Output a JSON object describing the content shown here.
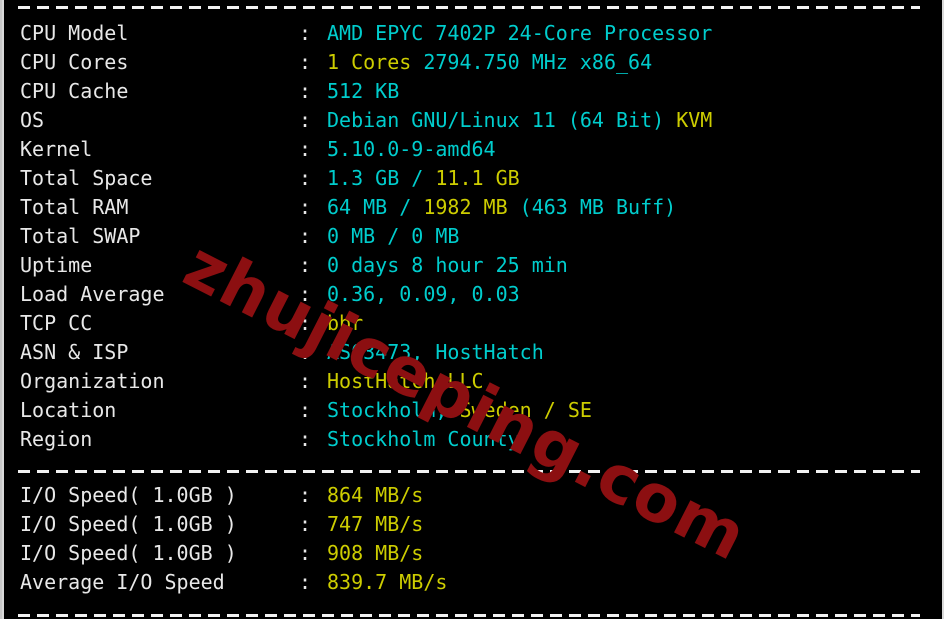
{
  "terminal": {
    "background_color": "#000000",
    "label_color": "#e8e8e8",
    "cyan": "#00cdcd",
    "yellow": "#cdcd00",
    "separator_char": "-"
  },
  "watermark": {
    "text": "zhujiceping.com",
    "color": "#8c0f11"
  },
  "separators": {
    "top": "----------------------------------------------------------------------",
    "middle": "----------------------------------------------------------------------",
    "bottom": "----------------------------------------------------------------------"
  },
  "system_info": {
    "colon": ":",
    "rows": [
      {
        "label": "CPU Model",
        "value_plain": "AMD EPYC 7402P 24-Core Processor",
        "parts": [
          {
            "text": "AMD EPYC 7402P 24-Core Processor",
            "color": "cyan"
          }
        ]
      },
      {
        "label": "CPU Cores",
        "value_plain": "1 Cores 2794.750 MHz x86_64",
        "parts": [
          {
            "text": "1 Cores",
            "color": "yellow"
          },
          {
            "text": " 2794.750 MHz x86_64",
            "color": "cyan"
          }
        ]
      },
      {
        "label": "CPU Cache",
        "value_plain": "512 KB",
        "parts": [
          {
            "text": "512 KB",
            "color": "cyan"
          }
        ]
      },
      {
        "label": "OS",
        "value_plain": "Debian GNU/Linux 11 (64 Bit) KVM",
        "parts": [
          {
            "text": "Debian GNU/Linux 11 (64 Bit) ",
            "color": "cyan"
          },
          {
            "text": "KVM",
            "color": "yellow"
          }
        ]
      },
      {
        "label": "Kernel",
        "value_plain": "5.10.0-9-amd64",
        "parts": [
          {
            "text": "5.10.0-9-amd64",
            "color": "cyan"
          }
        ]
      },
      {
        "label": "Total Space",
        "value_plain": "1.3 GB / 11.1 GB",
        "parts": [
          {
            "text": "1.3 GB / ",
            "color": "cyan"
          },
          {
            "text": "11.1 GB",
            "color": "yellow"
          }
        ]
      },
      {
        "label": "Total RAM",
        "value_plain": "64 MB / 1982 MB (463 MB Buff)",
        "parts": [
          {
            "text": "64 MB / ",
            "color": "cyan"
          },
          {
            "text": "1982 MB",
            "color": "yellow"
          },
          {
            "text": " (463 MB Buff)",
            "color": "cyan"
          }
        ]
      },
      {
        "label": "Total SWAP",
        "value_plain": "0 MB / 0 MB",
        "parts": [
          {
            "text": "0 MB / 0 MB",
            "color": "cyan"
          }
        ]
      },
      {
        "label": "Uptime",
        "value_plain": "0 days 8 hour 25 min",
        "parts": [
          {
            "text": "0 days 8 hour 25 min",
            "color": "cyan"
          }
        ]
      },
      {
        "label": "Load Average",
        "value_plain": "0.36, 0.09, 0.03",
        "parts": [
          {
            "text": "0.36, 0.09, 0.03",
            "color": "cyan"
          }
        ]
      },
      {
        "label": "TCP CC",
        "value_plain": "bbr",
        "parts": [
          {
            "text": "bbr",
            "color": "yellow"
          }
        ]
      },
      {
        "label": "ASN & ISP",
        "value_plain": "AS63473, HostHatch",
        "parts": [
          {
            "text": "AS63473, HostHatch",
            "color": "cyan"
          }
        ]
      },
      {
        "label": "Organization",
        "value_plain": "HostHatch LLC",
        "parts": [
          {
            "text": "HostHatch LLC",
            "color": "yellow"
          }
        ]
      },
      {
        "label": "Location",
        "value_plain": "Stockholm, Sweden / SE",
        "parts": [
          {
            "text": "Stockholm, ",
            "color": "cyan"
          },
          {
            "text": "Sweden / SE",
            "color": "yellow"
          }
        ]
      },
      {
        "label": "Region",
        "value_plain": "Stockholm County",
        "parts": [
          {
            "text": "Stockholm County",
            "color": "cyan"
          }
        ]
      }
    ]
  },
  "io_speed": {
    "colon": ":",
    "rows": [
      {
        "label": "I/O Speed( 1.0GB )",
        "value_plain": "864 MB/s",
        "parts": [
          {
            "text": "864 MB/s",
            "color": "yellow"
          }
        ]
      },
      {
        "label": "I/O Speed( 1.0GB )",
        "value_plain": "747 MB/s",
        "parts": [
          {
            "text": "747 MB/s",
            "color": "yellow"
          }
        ]
      },
      {
        "label": "I/O Speed( 1.0GB )",
        "value_plain": "908 MB/s",
        "parts": [
          {
            "text": "908 MB/s",
            "color": "yellow"
          }
        ]
      },
      {
        "label": "Average I/O Speed",
        "value_plain": "839.7 MB/s",
        "parts": [
          {
            "text": "839.7 MB/s",
            "color": "yellow"
          }
        ]
      }
    ]
  }
}
